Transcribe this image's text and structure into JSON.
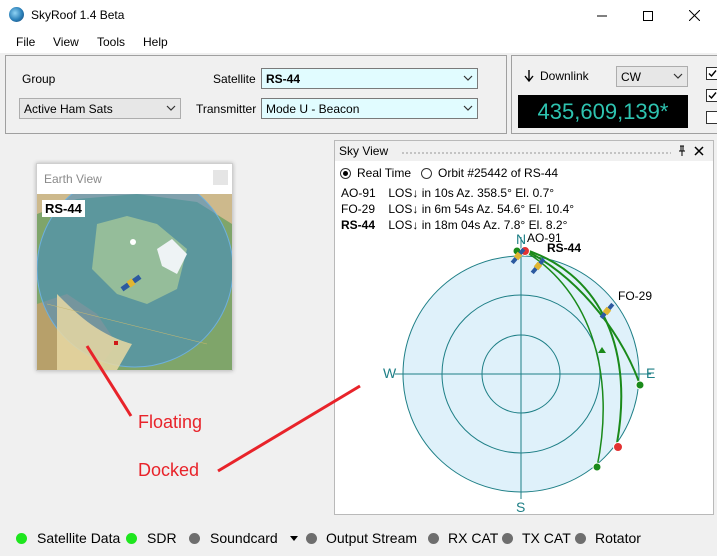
{
  "window": {
    "title": "SkyRoof 1.4 Beta"
  },
  "menu": [
    "File",
    "View",
    "Tools",
    "Help"
  ],
  "top_panel": {
    "group_label": "Group",
    "group_value": "Active Ham Sats",
    "satellite_label": "Satellite",
    "satellite_value": "RS-44",
    "transmitter_label": "Transmitter",
    "transmitter_value": "Mode U - Beacon"
  },
  "downlink": {
    "label": "Downlink",
    "mode": "CW",
    "frequency": "435,609,139*"
  },
  "earth_view": {
    "title": "Earth View",
    "sat_label": "RS-44"
  },
  "sky_view": {
    "title": "Sky View",
    "realtime_label": "Real Time",
    "orbit_label": "Orbit #25442 of RS-44",
    "passes": [
      {
        "name": "AO-91",
        "los": "LOS↓",
        "time": "in 10s",
        "az": "Az. 358.5°",
        "el": "El. 0.7°",
        "bold": false
      },
      {
        "name": "FO-29",
        "los": "LOS↓",
        "time": "in 6m 54s",
        "az": "Az. 54.6°",
        "el": "El. 10.4°",
        "bold": false
      },
      {
        "name": "RS-44",
        "los": "LOS↓",
        "time": "in 18m 04s",
        "az": "Az. 7.8°",
        "el": "El. 8.2°",
        "bold": true
      }
    ],
    "compass": {
      "n": "N",
      "e": "E",
      "s": "S",
      "w": "W"
    },
    "sat_labels": {
      "ao91": "AO-91",
      "rs44": "RS-44",
      "fo29": "FO-29"
    },
    "colors": {
      "ring": "#1e7f86",
      "track": "#1a8a1a",
      "fill": "#dff1fa"
    }
  },
  "annotations": {
    "floating": "Floating",
    "docked": "Docked"
  },
  "status": [
    {
      "label": "Satellite Data",
      "color": "#1ee61e"
    },
    {
      "label": "SDR",
      "color": "#1ee61e"
    },
    {
      "label": "Soundcard",
      "color": "#6e6e6e"
    },
    {
      "label": "Output Stream",
      "color": "#6e6e6e"
    },
    {
      "label": "RX CAT",
      "color": "#6e6e6e"
    },
    {
      "label": "TX CAT",
      "color": "#6e6e6e"
    },
    {
      "label": "Rotator",
      "color": "#6e6e6e"
    }
  ]
}
